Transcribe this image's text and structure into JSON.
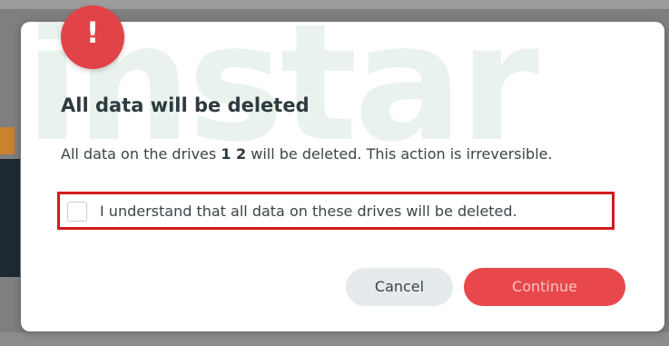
{
  "dialog": {
    "watermark": "instar",
    "alert_symbol": "!",
    "title": "All data will be deleted",
    "message_prefix": "All data on the drives ",
    "drives": "1 2",
    "message_suffix": " will be deleted. This action is irreversible.",
    "confirm_label": "I understand that all data on these drives will be deleted.",
    "confirm_checked": false,
    "cancel_label": "Cancel",
    "continue_label": "Continue",
    "colors": {
      "accent": "#e8474b",
      "highlight_border": "#d01c1f",
      "watermark": "#e9f2ec"
    }
  }
}
